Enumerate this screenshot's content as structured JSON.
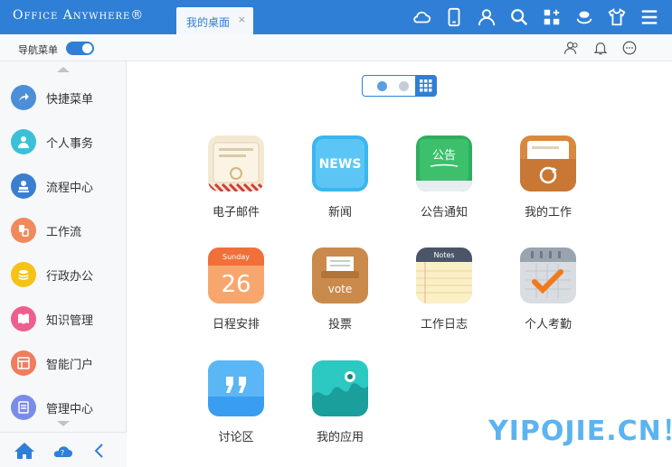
{
  "app": {
    "logo": "Office Anywhere®"
  },
  "tabs": [
    {
      "label": "我的桌面",
      "close": "×"
    }
  ],
  "top_icons": [
    "cloud-icon",
    "mobile-icon",
    "user-icon",
    "search-icon",
    "apps-add-icon",
    "skin-icon",
    "shirt-icon",
    "menu-icon"
  ],
  "subbar": {
    "nav_label": "导航菜单",
    "toggle_on": true
  },
  "sub_icons": [
    "contacts-icon",
    "bell-icon",
    "chat-icon"
  ],
  "sidebar": {
    "items": [
      {
        "label": "快捷菜单",
        "icon": "share-icon",
        "color": "#4a8fd8"
      },
      {
        "label": "个人事务",
        "icon": "person-icon",
        "color": "#3cc0d9"
      },
      {
        "label": "流程中心",
        "icon": "stamp-icon",
        "color": "#3a7fcf"
      },
      {
        "label": "工作流",
        "icon": "workflow-icon",
        "color": "#f08a5d"
      },
      {
        "label": "行政办公",
        "icon": "coins-icon",
        "color": "#f5c315"
      },
      {
        "label": "知识管理",
        "icon": "book-icon",
        "color": "#ef5f8e"
      },
      {
        "label": "智能门户",
        "icon": "portal-icon",
        "color": "#f07d5e"
      },
      {
        "label": "管理中心",
        "icon": "manage-icon",
        "color": "#7b8ce8"
      }
    ],
    "footer_icons": [
      "home-icon",
      "cloud-help-icon",
      "collapse-icon"
    ]
  },
  "pager": {
    "pages": 2,
    "active_page": 1
  },
  "apps": [
    {
      "label": "电子邮件",
      "icon": "email-app-icon"
    },
    {
      "label": "新闻",
      "icon": "news-app-icon",
      "icon_text": "NEWS"
    },
    {
      "label": "公告通知",
      "icon": "notice-app-icon",
      "icon_text": "公告"
    },
    {
      "label": "我的工作",
      "icon": "my-work-app-icon"
    },
    {
      "label": "日程安排",
      "icon": "calendar-app-icon",
      "icon_text": "Sunday",
      "icon_day": "26"
    },
    {
      "label": "投票",
      "icon": "vote-app-icon",
      "icon_text": "vote"
    },
    {
      "label": "工作日志",
      "icon": "notes-app-icon",
      "icon_text": "Notes"
    },
    {
      "label": "个人考勤",
      "icon": "attendance-app-icon"
    },
    {
      "label": "讨论区",
      "icon": "discussion-app-icon"
    },
    {
      "label": "我的应用",
      "icon": "my-apps-app-icon"
    }
  ],
  "watermark": "YIPOJIE.CN！",
  "colors": {
    "primary": "#2f7fd6",
    "sidebar_bg": "#f7f8fa"
  }
}
